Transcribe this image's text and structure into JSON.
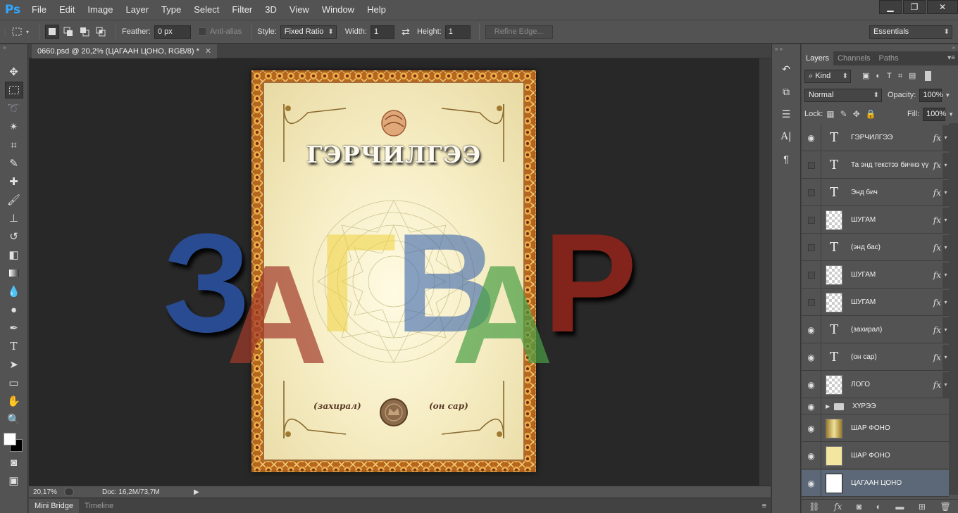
{
  "app": {
    "logo": "Ps"
  },
  "menu": [
    "File",
    "Edit",
    "Image",
    "Layer",
    "Type",
    "Select",
    "Filter",
    "3D",
    "View",
    "Window",
    "Help"
  ],
  "window_controls": {
    "minimize": "▁",
    "restore": "❐",
    "close": "✕"
  },
  "options": {
    "feather_label": "Feather:",
    "feather_value": "0 px",
    "antialias_label": "Anti-alias",
    "style_label": "Style:",
    "style_value": "Fixed Ratio",
    "width_label": "Width:",
    "width_value": "1",
    "height_label": "Height:",
    "height_value": "1",
    "refine_edge": "Refine Edge...",
    "workspace": "Essentials"
  },
  "document": {
    "tab_title": "0660.psd @ 20,2% (ЦАГААН ЦОНО, RGB/8) *",
    "tab_close": "✕",
    "zoom": "20,17%",
    "doc_info": "Doc: 16,2M/73,7M"
  },
  "certificate": {
    "title": "ГЭРЧИЛГЭЭ",
    "left_caption": "(захирал)",
    "right_caption": "(он сар)"
  },
  "watermark": {
    "letters": [
      "З",
      "А",
      "Г",
      "В",
      "А",
      "Р"
    ],
    "colors": {
      "blue": "#2a4f9a",
      "red": "#a23a2a",
      "yellow": "#f0d23c",
      "green": "#4aa046",
      "darkred": "#8a241a"
    }
  },
  "bottom_tabs": [
    "Mini Bridge",
    "Timeline"
  ],
  "layers_panel": {
    "tabs": [
      "Layers",
      "Channels",
      "Paths"
    ],
    "kind_filter": "Kind",
    "blend_mode": "Normal",
    "opacity_label": "Opacity:",
    "opacity_value": "100%",
    "lock_label": "Lock:",
    "fill_label": "Fill:",
    "fill_value": "100%",
    "layers": [
      {
        "name": "ГЭРЧИЛГЭЭ",
        "type": "text",
        "visible": true,
        "fx": true
      },
      {
        "name": "Та энд текстээ бичнэ үү",
        "type": "text",
        "visible": false,
        "fx": true
      },
      {
        "name": "Энд бич",
        "type": "text",
        "visible": false,
        "fx": true
      },
      {
        "name": "ШУГАМ",
        "type": "pixel",
        "visible": false,
        "fx": true
      },
      {
        "name": "(энд бас)",
        "type": "text",
        "visible": false,
        "fx": true
      },
      {
        "name": "ШУГАМ",
        "type": "pixel",
        "visible": false,
        "fx": true
      },
      {
        "name": "ШУГАМ",
        "type": "pixel",
        "visible": false,
        "fx": true
      },
      {
        "name": "(захирал)",
        "type": "text",
        "visible": true,
        "fx": true
      },
      {
        "name": "(он сар)",
        "type": "text",
        "visible": true,
        "fx": true
      },
      {
        "name": "ЛОГО",
        "type": "pixel",
        "visible": true,
        "fx": true
      },
      {
        "name": "ХҮРЭЭ",
        "type": "group",
        "visible": true,
        "fx": false
      },
      {
        "name": "ШАР ФОНО",
        "type": "gradient",
        "visible": true,
        "fx": false
      },
      {
        "name": "ШАР ФОНО",
        "type": "fill-yellow",
        "visible": true,
        "fx": false
      },
      {
        "name": "ЦАГААН ЦОНО",
        "type": "fill-white",
        "visible": true,
        "fx": false
      }
    ],
    "fx_symbol": "fx"
  }
}
